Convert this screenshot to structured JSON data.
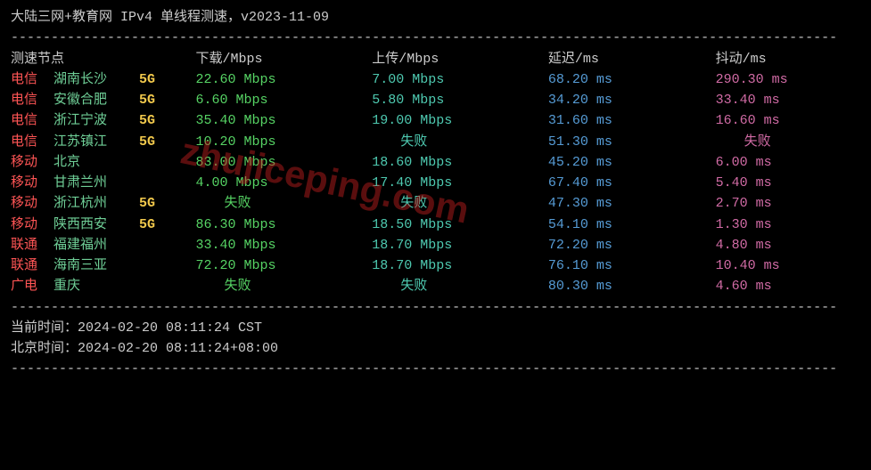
{
  "title": "大陆三网+教育网 IPv4 单线程测速，v2023-11-09",
  "dash": "------------------------------------------------------------------------------------------------------------",
  "headers": {
    "node": "测速节点",
    "download": "下载/Mbps",
    "upload": "上传/Mbps",
    "latency": "延迟/ms",
    "jitter": "抖动/ms"
  },
  "fail_text": "失败",
  "rows": [
    {
      "isp": "电信",
      "city": "湖南长沙",
      "tag": "5G",
      "dl": "22.60 Mbps",
      "ul": "7.00 Mbps",
      "lat": "68.20 ms",
      "jit": "290.30 ms"
    },
    {
      "isp": "电信",
      "city": "安徽合肥",
      "tag": "5G",
      "dl": "6.60 Mbps",
      "ul": "5.80 Mbps",
      "lat": "34.20 ms",
      "jit": "33.40 ms"
    },
    {
      "isp": "电信",
      "city": "浙江宁波",
      "tag": "5G",
      "dl": "35.40 Mbps",
      "ul": "19.00 Mbps",
      "lat": "31.60 ms",
      "jit": "16.60 ms"
    },
    {
      "isp": "电信",
      "city": "江苏镇江",
      "tag": "5G",
      "dl": "10.20 Mbps",
      "ul": "失败",
      "lat": "51.30 ms",
      "jit": "失败"
    },
    {
      "isp": "移动",
      "city": "北京",
      "tag": "",
      "dl": "83.00 Mbps",
      "ul": "18.60 Mbps",
      "lat": "45.20 ms",
      "jit": "6.00 ms"
    },
    {
      "isp": "移动",
      "city": "甘肃兰州",
      "tag": "",
      "dl": "4.00 Mbps",
      "ul": "17.40 Mbps",
      "lat": "67.40 ms",
      "jit": "5.40 ms"
    },
    {
      "isp": "移动",
      "city": "浙江杭州",
      "tag": "5G",
      "dl": "失败",
      "ul": "失败",
      "lat": "47.30 ms",
      "jit": "2.70 ms"
    },
    {
      "isp": "移动",
      "city": "陕西西安",
      "tag": "5G",
      "dl": "86.30 Mbps",
      "ul": "18.50 Mbps",
      "lat": "54.10 ms",
      "jit": "1.30 ms"
    },
    {
      "isp": "联通",
      "city": "福建福州",
      "tag": "",
      "dl": "33.40 Mbps",
      "ul": "18.70 Mbps",
      "lat": "72.20 ms",
      "jit": "4.80 ms"
    },
    {
      "isp": "联通",
      "city": "海南三亚",
      "tag": "",
      "dl": "72.20 Mbps",
      "ul": "18.70 Mbps",
      "lat": "76.10 ms",
      "jit": "10.40 ms"
    },
    {
      "isp": "广电",
      "city": "重庆",
      "tag": "",
      "dl": "失败",
      "ul": "失败",
      "lat": "80.30 ms",
      "jit": "4.60 ms"
    }
  ],
  "footer": {
    "current_label": "当前时间：",
    "current_value": "2024-02-20 08:11:24 CST",
    "beijing_label": "北京时间：",
    "beijing_value": "2024-02-20 08:11:24+08:00"
  },
  "watermark": "zhujiceping.com"
}
